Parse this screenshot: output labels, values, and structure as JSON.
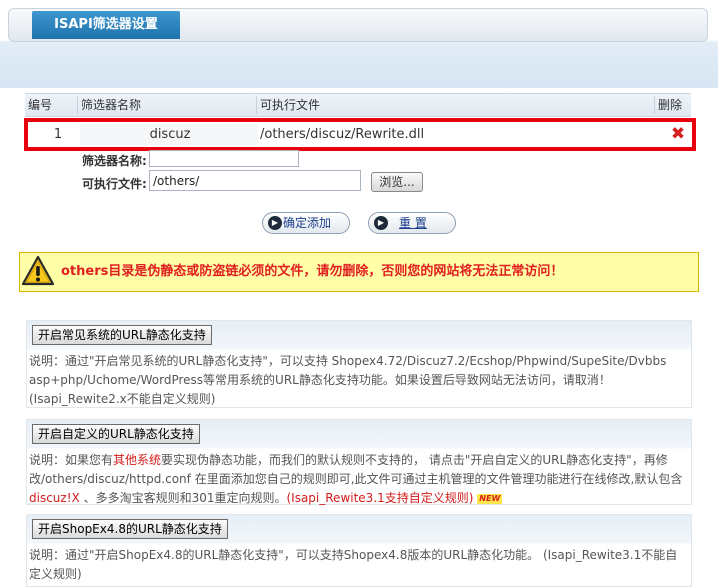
{
  "header": {
    "title": "ISAPI筛选器设置"
  },
  "table": {
    "columns": {
      "id": "编号",
      "name": "筛选器名称",
      "path": "可执行文件",
      "delete": "删除"
    },
    "rows": [
      {
        "id": "1",
        "name": "discuz",
        "path": "/others/discuz/Rewrite.dll"
      }
    ]
  },
  "form": {
    "name_label": "筛选器名称:",
    "name_value": "",
    "path_label": "可执行文件:",
    "path_value": "/others/",
    "browse_label": "浏览...",
    "add_label": "确定添加",
    "reset_label": "重 置"
  },
  "warning": {
    "text": "others目录是伪静态或防盗链必须的文件，请勿删除，否则您的网站将无法正常访问！"
  },
  "sections": [
    {
      "button": "开启常见系统的URL静态化支持",
      "desc": "说明：通过\"开启常见系统的URL静态化支持\"，可以支持 Shopex4.72/Discuz7.2/Ecshop/Phpwind/SupeSite/Dvbbs asp+php/Uchome/WordPress等常用系统的URL静态化支持功能。如果设置后导致网站无法访问，请取消！(Isapi_Rewite2.x不能自定义规则)"
    },
    {
      "button": "开启自定义的URL静态化支持",
      "desc_1": "说明：如果您有",
      "desc_red_1": "其他系统",
      "desc_2": "要实现伪静态功能，而我们的默认规则不支持的， 请点击\"开启自定义的URL静态化支持\"，再修改/others/discuz/httpd.conf 在里面添加您自己的规则即可,此文件可通过主机管理的文件管理功能进行在线修改,默认包含",
      "desc_red_2": "discuz!X",
      "desc_3": " 、多多淘宝客规则和301重定向规则。",
      "desc_red_3": "(Isapi_Rewite3.1支持自定义规则)",
      "badge": "NEW"
    },
    {
      "button": "开启ShopEx4.8的URL静态化支持",
      "desc": "说明：通过\"开启ShopEx4.8的URL静态化支持\"，可以支持Shopex4.8版本的URL静态化功能。 (Isapi_Rewite3.1不能自定义规则)"
    }
  ],
  "colors": {
    "accent": "#1e73ad",
    "warning_text": "#e02020",
    "warning_bg": "#ffffa8",
    "highlight_border": "#e8000f"
  },
  "icons": {
    "delete": "close-x-icon",
    "warning": "warning-triangle-icon",
    "button_bullet": "circle-arrow-icon"
  }
}
